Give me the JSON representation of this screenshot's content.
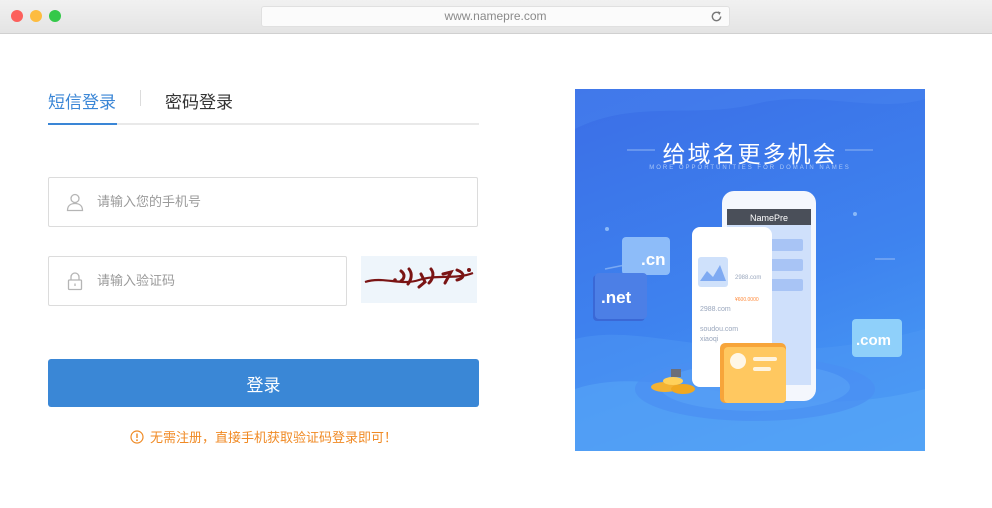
{
  "browser": {
    "url": "www.namepre.com",
    "colors": {
      "close": "#fc605c",
      "minimize": "#fdbc40",
      "maximize": "#34c84a"
    }
  },
  "login": {
    "tabs": [
      {
        "label": "短信登录",
        "active": true
      },
      {
        "label": "密码登录",
        "active": false
      }
    ],
    "phone_placeholder": "请输入您的手机号",
    "code_placeholder": "请输入验证码",
    "submit_label": "登录",
    "notice": "无需注册，直接手机获取验证码登录即可！",
    "accent_color": "#3a86d6",
    "notice_color": "#f08a24"
  },
  "promo": {
    "title": "给域名更多机会",
    "subtitle": "MORE OPPORTUNITIES FOR DOMAIN NAMES",
    "phone_brand": "NamePre",
    "badges": [
      ".cn",
      ".net",
      ".com"
    ],
    "screen_lines": [
      "2988.com",
      "¥600.0000",
      "2988.com",
      "soudou.com",
      "xiaoqi"
    ]
  }
}
